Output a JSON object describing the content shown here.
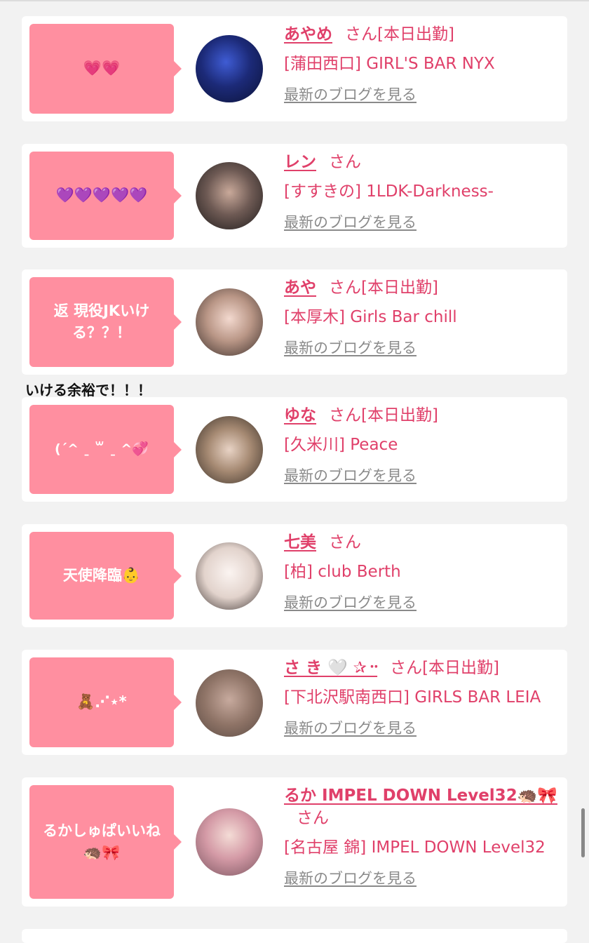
{
  "overlay_caption": "いける余裕で！！！",
  "entries": [
    {
      "bubble": "💗💗",
      "name": "あやめ",
      "san": "さん",
      "status": "[本日出勤]",
      "shop": "[蒲田西口] GIRL'S BAR NYX",
      "blog": "最新のブログを見る",
      "avatar_color": "#1a2b6e"
    },
    {
      "bubble": "💜💜💜💜💜",
      "name": "レン",
      "san": "さん",
      "status": "",
      "shop": "[すすきの] 1LDK-Darkness-",
      "blog": "最新のブログを見る",
      "avatar_color": "#5a4a44"
    },
    {
      "bubble": "返 現役JKいける？？！",
      "name": "あや",
      "san": "さん",
      "status": "[本日出勤]",
      "shop": "[本厚木] Girls Bar chill",
      "blog": "最新のブログを見る",
      "avatar_color": "#c8a89a"
    },
    {
      "bubble": "(ˊ^ ˍ ꒳ ˍ ^💞",
      "name": "ゆな",
      "san": "さん",
      "status": "[本日出勤]",
      "shop": "[久米川] Peace",
      "blog": "最新のブログを見る",
      "avatar_color": "#9a7b63"
    },
    {
      "bubble": "天使降臨👶",
      "name": "七美",
      "san": "さん",
      "status": "",
      "shop": "[柏] club Berth",
      "blog": "最新のブログを見る",
      "avatar_color": "#e9dcd6"
    },
    {
      "bubble": "🧸⋰⋆*",
      "name": "さ き 🤍 ✰᠃",
      "san": "さん",
      "status": "[本日出勤]",
      "shop": "[下北沢駅南西口] GIRLS BAR LEIA",
      "blog": "最新のブログを見る",
      "avatar_color": "#8b7466"
    },
    {
      "bubble": "るかしゅぱいいね🦔🎀",
      "name": "るか IMPEL DOWN Level32🦔🎀",
      "san": "さん",
      "status": "",
      "shop": "[名古屋 錦] IMPEL DOWN Level32",
      "blog": "最新のブログを見る",
      "avatar_color": "#d9a7b0"
    }
  ]
}
